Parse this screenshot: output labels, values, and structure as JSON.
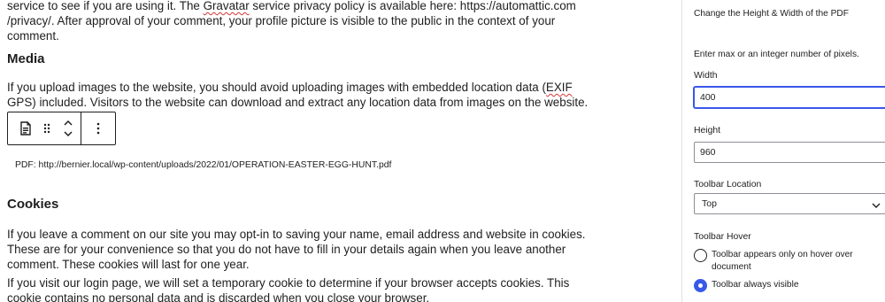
{
  "editor": {
    "para_privacy": {
      "line1_a": "service to see if you are using it. The ",
      "line1_gravatar": "Gravatar",
      "line1_b": " service privacy policy is available here: https://automattic.com",
      "line2": "/privacy/. After approval of your comment, your profile picture is visible to the public in the context of your",
      "line3": "comment."
    },
    "heading_media": "Media",
    "para_media": {
      "line1_a": "If you upload images to the website, you should avoid uploading images with embedded location data (",
      "line1_exif": "EXIF",
      "line2": "GPS) included. Visitors to the website can download and extract any location data from images on the website."
    },
    "pdf_embed_text": "PDF: http://bernier.local/wp-content/uploads/2022/01/OPERATION-EASTER-EGG-HUNT.pdf",
    "heading_cookies": "Cookies",
    "para_cookies_1": {
      "line1": "If you leave a comment on our site you may opt-in to saving your name, email address and website in cookies.",
      "line2": "These are for your convenience so that you do not have to fill in your details again when you leave another",
      "line3": "comment. These cookies will last for one year."
    },
    "para_cookies_2": {
      "line1": "If you visit our login page, we will set a temporary cookie to determine if your browser accepts cookies. This",
      "line2": "cookie contains no personal data and is discarded when you close your browser."
    },
    "toolbar_icons": [
      "pdf-block-icon",
      "drag-handle-icon",
      "move-up-down-icon",
      "more-options-icon"
    ]
  },
  "sidebar": {
    "size_heading": "Change the Height & Width of the PDF",
    "size_help": "Enter max or an integer number of pixels.",
    "width_label": "Width",
    "width_value": "400",
    "height_label": "Height",
    "height_value": "960",
    "toolbar_location_label": "Toolbar Location",
    "toolbar_location_value": "Top",
    "toolbar_hover_label": "Toolbar Hover",
    "hover_option_1": "Toolbar appears only on hover over document",
    "hover_option_2": "Toolbar always visible",
    "hover_selected": 2,
    "accent_color": "#3858e9"
  }
}
